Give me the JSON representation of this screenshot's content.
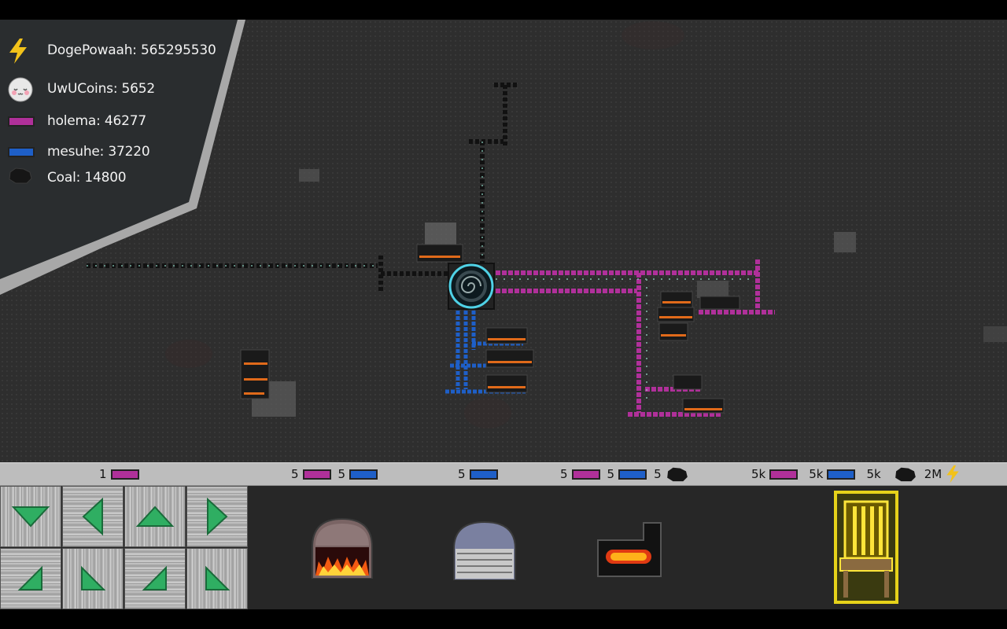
{
  "resources": [
    {
      "name": "dogepowaah",
      "icon": "lightning-icon",
      "text": "DogePowaah: 565295530"
    },
    {
      "name": "uwucoins",
      "icon": "uwu-coin-icon",
      "text": "UwUCoins: 5652"
    },
    {
      "name": "holema",
      "icon": "holema-bar-icon",
      "text": "holema: 46277"
    },
    {
      "name": "mesuhe",
      "icon": "mesuhe-bar-icon",
      "text": "mesuhe: 37220"
    },
    {
      "name": "coal",
      "icon": "coal-icon",
      "text": "Coal: 14800"
    }
  ],
  "costs": [
    {
      "parts": [
        {
          "n": "1",
          "res": "holema"
        }
      ]
    },
    {
      "parts": [
        {
          "n": "5",
          "res": "holema"
        },
        {
          "n": "5",
          "res": "mesuhe"
        }
      ]
    },
    {
      "parts": [
        {
          "n": "5",
          "res": "mesuhe"
        }
      ]
    },
    {
      "parts": [
        {
          "n": "5",
          "res": "holema"
        },
        {
          "n": "5",
          "res": "mesuhe"
        },
        {
          "n": "5",
          "res": "coal"
        }
      ]
    },
    {
      "parts": [
        {
          "n": "5k",
          "res": "holema"
        },
        {
          "n": "5k",
          "res": "mesuhe"
        },
        {
          "n": "5k",
          "res": "coal"
        },
        {
          "n": "2M",
          "res": "power"
        }
      ]
    }
  ],
  "tools": [
    {
      "name": "conveyor-tool",
      "icon": "conveyor-arrows-icon"
    },
    {
      "name": "furnace-tool",
      "icon": "furnace-icon"
    },
    {
      "name": "press-tool",
      "icon": "press-icon"
    },
    {
      "name": "smelter-tool",
      "icon": "smelter-icon"
    },
    {
      "name": "chair-tool",
      "icon": "golden-chair-icon",
      "selected": true
    }
  ],
  "colors": {
    "holema": "#b0309a",
    "mesuhe": "#1e5fc8",
    "coal": "#1a1a1a",
    "power": "#f2c21a",
    "selection": "#e6d21a",
    "arrow": "#2fae62"
  }
}
